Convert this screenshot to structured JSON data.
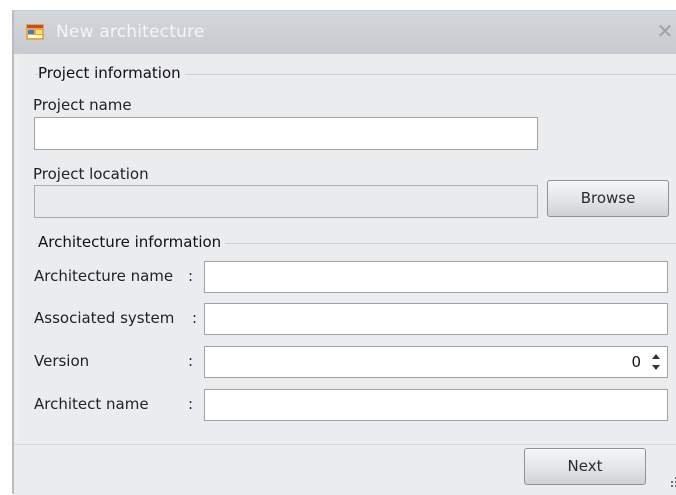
{
  "window": {
    "title": "New architecture",
    "close_glyph": "✕"
  },
  "project_info": {
    "group_title": "Project information",
    "project_name_label": "Project name",
    "project_name_value": "",
    "project_location_label": "Project location",
    "project_location_value": "",
    "browse_label": "Browse"
  },
  "architecture_info": {
    "group_title": "Architecture information",
    "fields": [
      {
        "label": "Architecture name",
        "value": ""
      },
      {
        "label": "Associated system",
        "value": ""
      },
      {
        "label": "Version",
        "value": "0"
      },
      {
        "label": "Architect name",
        "value": ""
      }
    ],
    "colon": ":"
  },
  "footer": {
    "next_label": "Next"
  },
  "icons": {
    "app": "app-window-icon",
    "close": "close-icon",
    "spin_up": "spin-up-icon",
    "spin_down": "spin-down-icon",
    "grip": "resize-grip-icon"
  },
  "colors": {
    "titlebar": "#c9cdd2",
    "title_text": "#f4f5f6",
    "dialog_bg": "#ebecee",
    "input_border": "#9ea3a8"
  }
}
